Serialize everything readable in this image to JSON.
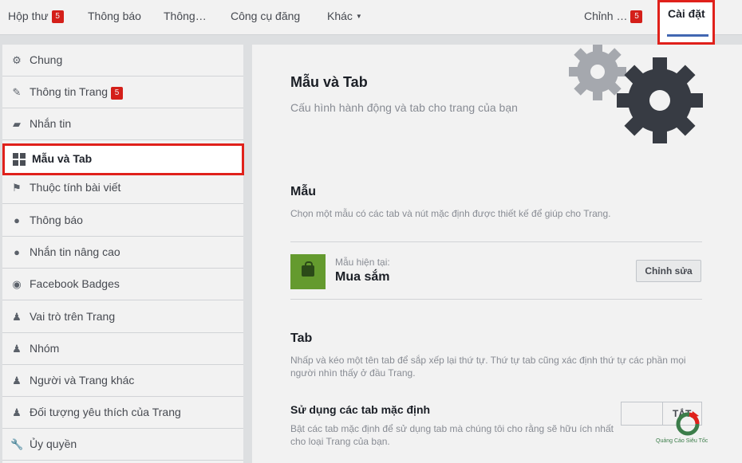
{
  "topnav": {
    "inbox": {
      "label": "Hộp thư",
      "badge": "5"
    },
    "notifications": "Thông báo",
    "insights": "Thông…",
    "publishing_tools": "Công cụ đăng",
    "more": "Khác",
    "edit_page": {
      "label": "Chỉnh …",
      "badge": "5"
    },
    "settings": "Cài đặt"
  },
  "sidebar": {
    "items": [
      {
        "label": "Chung",
        "icon": "gear-icon"
      },
      {
        "label": "Thông tin Trang",
        "icon": "pencil-icon",
        "badge": "5"
      },
      {
        "label": "Nhắn tin",
        "icon": "messages-icon"
      },
      {
        "label": "Mẫu và Tab",
        "icon": "grid-icon",
        "active": true
      },
      {
        "label": "Thuộc tính bài viết",
        "icon": "flag-icon"
      },
      {
        "label": "Thông báo",
        "icon": "globe-icon"
      },
      {
        "label": "Nhắn tin nâng cao",
        "icon": "chat-bubble-icon"
      },
      {
        "label": "Facebook Badges",
        "icon": "badge-icon"
      },
      {
        "label": "Vai trò trên Trang",
        "icon": "person-icon"
      },
      {
        "label": "Nhóm",
        "icon": "group-icon"
      },
      {
        "label": "Người và Trang khác",
        "icon": "person-plus-icon"
      },
      {
        "label": "Đối tượng yêu thích của Trang",
        "icon": "person-star-icon"
      },
      {
        "label": "Ủy quyền",
        "icon": "wrench-icon"
      }
    ]
  },
  "main": {
    "title": "Mẫu và Tab",
    "subtitle": "Cấu hình hành động và tab cho trang của bạn",
    "template": {
      "heading": "Mẫu",
      "description": "Chọn một mẫu có các tab và nút mặc định được thiết kế để giúp cho Trang.",
      "current_label": "Mẫu hiện tại:",
      "current_name": "Mua sắm",
      "edit_button": "Chỉnh sửa"
    },
    "tabs": {
      "heading": "Tab",
      "description_line1": "Nhấp và kéo một tên tab để sắp xếp lại thứ tự. Thứ tự tab cũng xác định thứ tự các phần mọi",
      "description_line2": "người nhìn thấy ở đầu Trang.",
      "default_label": "Sử dụng các tab mặc định",
      "default_desc_line1": "Bật các tab mặc định để sử dụng tab mà chúng tôi cho rằng sẽ hữu ích nhất",
      "default_desc_line2": "cho loại Trang của bạn.",
      "toggle_label": "TẮT"
    }
  },
  "watermark": {
    "text": "Quảng Cáo Siêu Tốc"
  },
  "colors": {
    "accent": "#4267b2",
    "highlight": "#e0211b",
    "badge": "#e0211b",
    "template_thumb": "#6aa331"
  }
}
